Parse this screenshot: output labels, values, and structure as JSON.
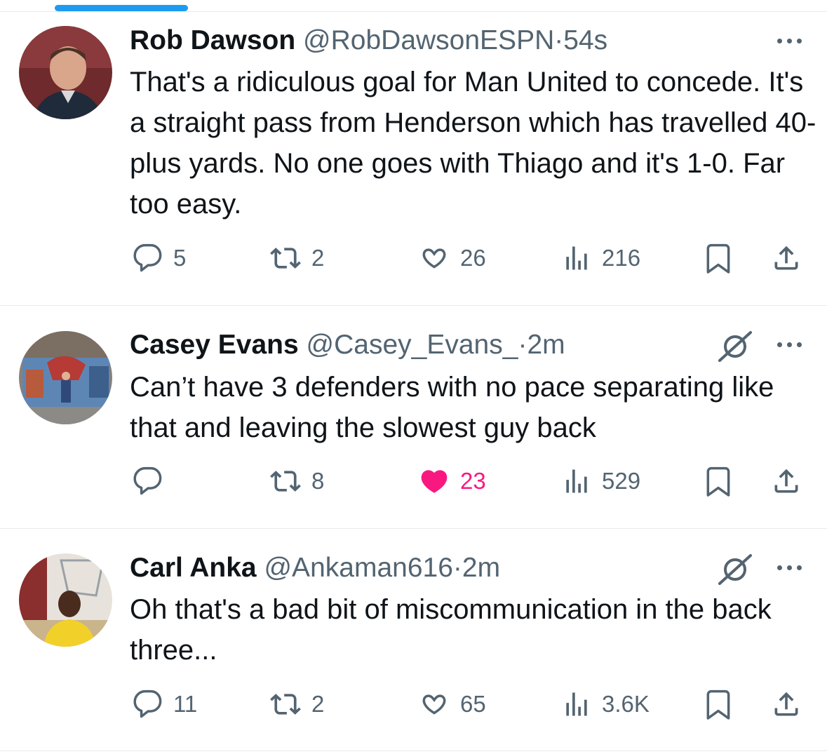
{
  "colors": {
    "accent": "#1d9bf0",
    "like_active": "#f91880",
    "muted": "#536471"
  },
  "tweets": [
    {
      "name": "Rob Dawson",
      "handle": "@RobDawsonESPN",
      "separator": "·",
      "time": "54s",
      "text": "That's a ridiculous goal for Man United to concede. It's a straight pass from Henderson which has travelled 40-plus yards. No one goes with Thiago and it's 1-0. Far too easy.",
      "replies": "5",
      "retweets": "2",
      "likes": "26",
      "views": "216",
      "liked": false,
      "grok_icon": false
    },
    {
      "name": "Casey Evans",
      "handle": "@Casey_Evans_",
      "separator": "·",
      "time": "2m",
      "text": "Can’t have 3 defenders with no pace separating like that and leaving the slowest guy back",
      "replies": "",
      "retweets": "8",
      "likes": "23",
      "views": "529",
      "liked": true,
      "grok_icon": true
    },
    {
      "name": "Carl Anka",
      "handle": "@Ankaman616",
      "separator": "·",
      "time": "2m",
      "text": "Oh that's a bad bit of miscommunication in the back three...",
      "replies": "11",
      "retweets": "2",
      "likes": "65",
      "views": "3.6K",
      "liked": false,
      "grok_icon": true
    }
  ]
}
